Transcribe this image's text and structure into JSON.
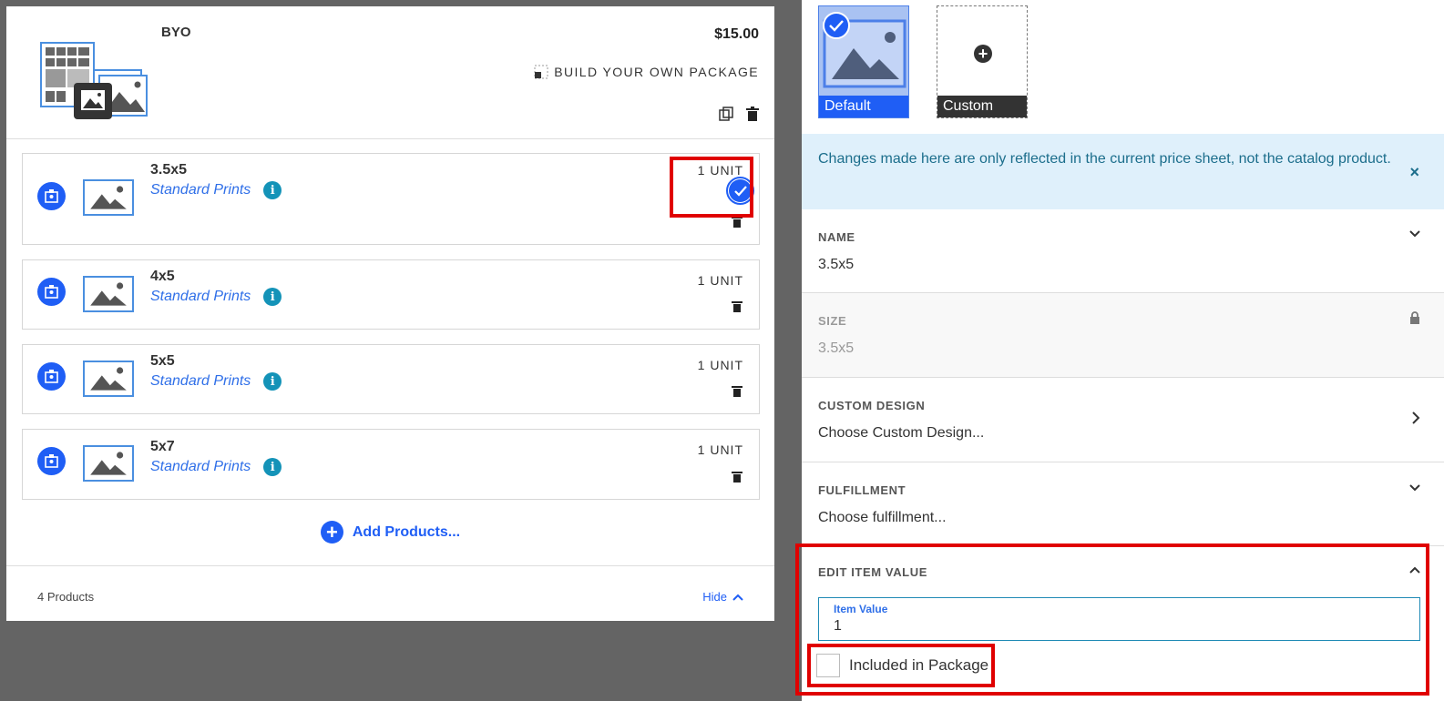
{
  "package": {
    "title": "BYO",
    "price": "$15.00",
    "type_label": "BUILD YOUR OWN PACKAGE"
  },
  "products": [
    {
      "name": "3.5x5",
      "category": "Standard Prints",
      "unit": "1 UNIT",
      "selected": true
    },
    {
      "name": "4x5",
      "category": "Standard Prints",
      "unit": "1 UNIT",
      "selected": false
    },
    {
      "name": "5x5",
      "category": "Standard Prints",
      "unit": "1 UNIT",
      "selected": false
    },
    {
      "name": "5x7",
      "category": "Standard Prints",
      "unit": "1 UNIT",
      "selected": false
    }
  ],
  "add_products_label": "Add Products...",
  "footer": {
    "count": "4 Products",
    "hide_label": "Hide"
  },
  "panel": {
    "tiles": [
      {
        "label": "Default",
        "selected": true
      },
      {
        "label": "Custom",
        "selected": false
      }
    ],
    "notice": "Changes made here are only reflected in the current price sheet, not the catalog product.",
    "notice_close": "×",
    "sections": {
      "name": {
        "title": "NAME",
        "value": "3.5x5"
      },
      "size": {
        "title": "SIZE",
        "value": "3.5x5"
      },
      "custom_design": {
        "title": "CUSTOM DESIGN",
        "value": "Choose Custom Design..."
      },
      "fulfillment": {
        "title": "FULFILLMENT",
        "value": "Choose fulfillment..."
      },
      "edit_item_value": {
        "title": "EDIT ITEM VALUE",
        "field_label": "Item Value",
        "field_value": "1",
        "checkbox_label": "Included in Package",
        "checkbox_checked": false
      }
    }
  },
  "colors": {
    "accent": "#1f5ef5",
    "highlight": "#e00000",
    "info": "#1493b8",
    "notice_bg": "#dff0fb"
  }
}
